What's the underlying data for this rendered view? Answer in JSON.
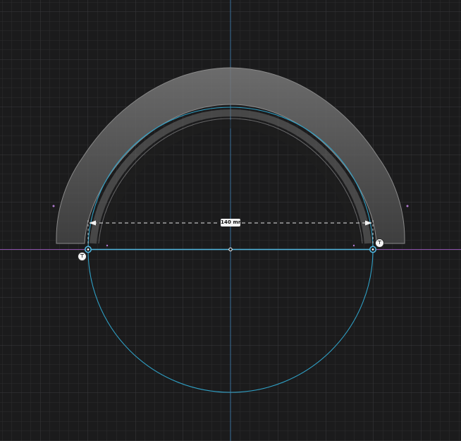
{
  "canvas": {
    "background_color": "#1b1b1c",
    "grid_minor_color": "#2c2c2e",
    "grid_major_color": "#3a3a3d",
    "vertical_axis_color": "#3a6f9a",
    "horizontal_axis_color": "#8a4fa8"
  },
  "sketch": {
    "circle_color": "#2f9fc4",
    "chord_color": "#4fb6e0",
    "endpoint_icon": "endpoint-node-icon",
    "midpoint_icon": "midpoint-node-icon"
  },
  "solid_body": {
    "fill_color": "#5a5a5a",
    "edge_color": "#777777"
  },
  "dimension": {
    "label": "140 mm",
    "line_color": "#e6e6e6"
  },
  "constraints": {
    "left_badge": "⊤",
    "right_badge": "⊤",
    "icon": "tangent-constraint-icon"
  }
}
